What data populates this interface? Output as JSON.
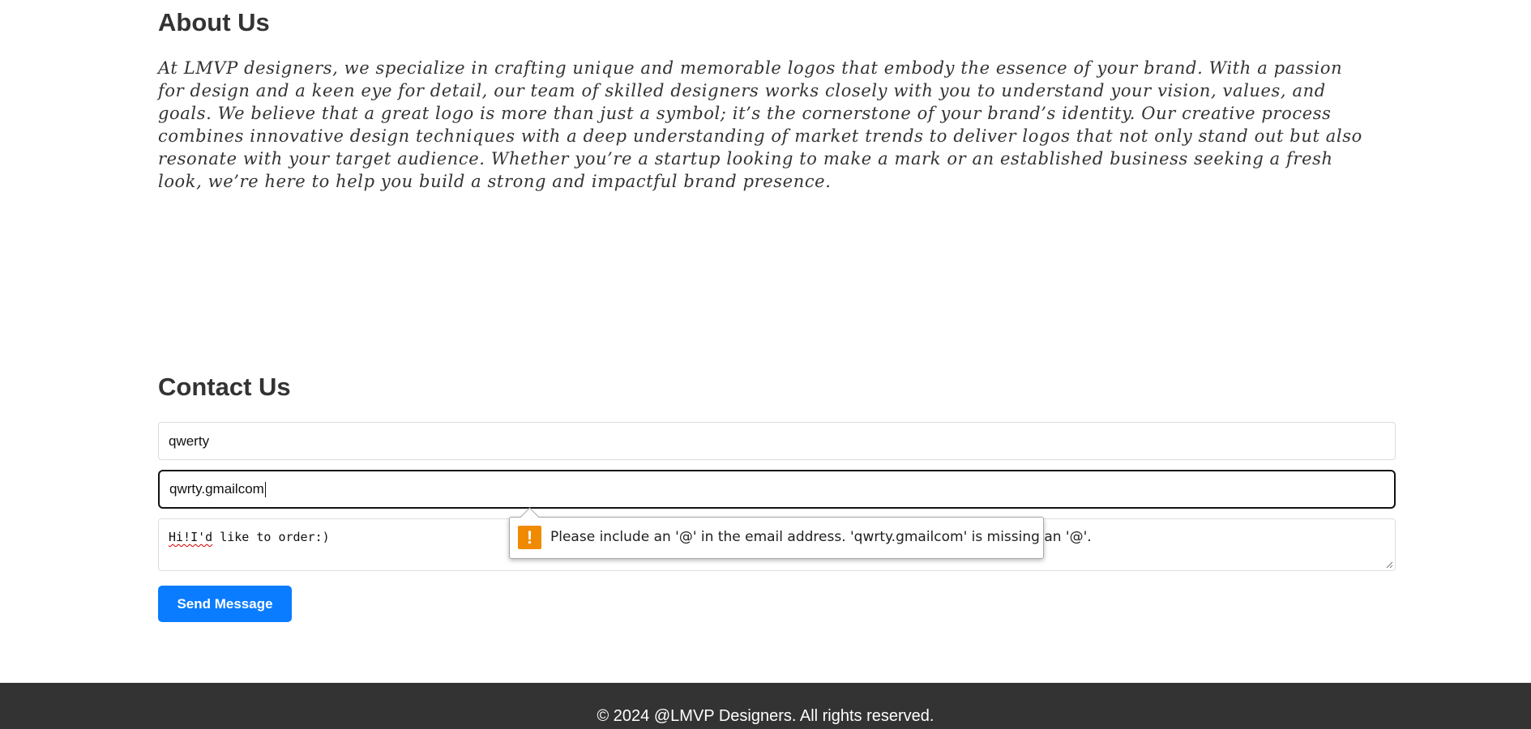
{
  "about": {
    "title": "About Us",
    "body": "At LMVP designers, we specialize in crafting unique and memorable logos that embody the essence of your brand. With a passion for design and a keen eye for detail, our team of skilled designers works closely with you to understand your vision, values, and goals. We believe that a great logo is more than just a symbol; it’s the cornerstone of your brand’s identity. Our creative process combines innovative design techniques with a deep understanding of market trends to deliver logos that not only stand out but also resonate with your target audience. Whether you’re a startup looking to make a mark or an established business seeking a fresh look, we’re here to help you build a strong and impactful brand presence."
  },
  "contact": {
    "title": "Contact Us",
    "name_value": "qwerty",
    "email_value": "qwrty.gmailcom",
    "message_misspelled": "Hi!I'd",
    "message_rest": " like to order:)",
    "send_label": "Send Message"
  },
  "validation": {
    "icon": "warning-icon",
    "icon_glyph": "!",
    "icon_color": "#f08a00",
    "message": "Please include an '@' in the email address. 'qwrty.gmailcom' is missing an '@'."
  },
  "colors": {
    "accent": "#0a7cff",
    "footer_bg": "#333333"
  },
  "footer": {
    "text": "© 2024 @LMVP Designers. All rights reserved."
  }
}
